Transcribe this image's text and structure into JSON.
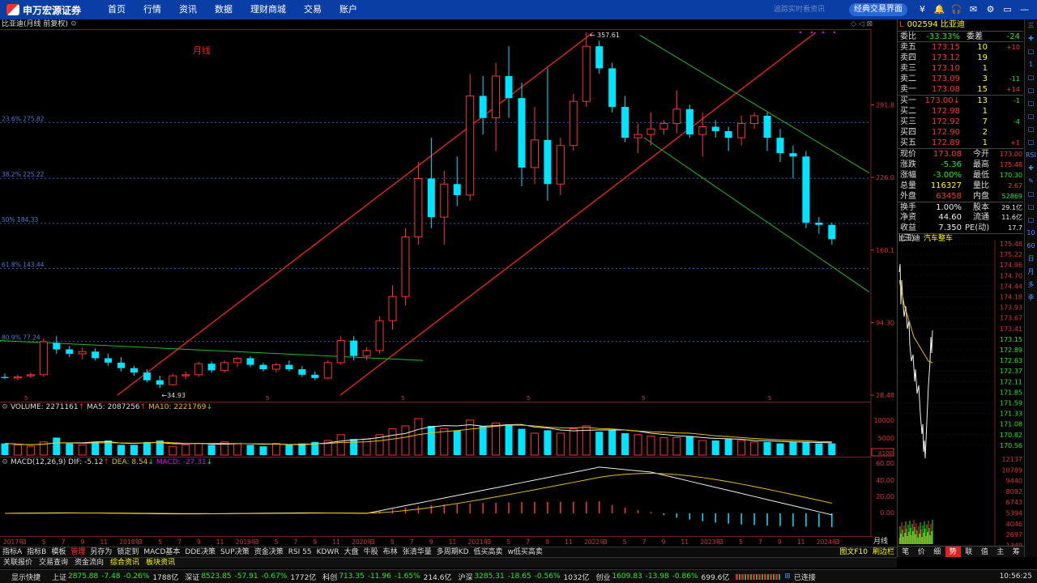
{
  "topbar": {
    "logo_text": "申万宏源证券",
    "nav": [
      "首页",
      "行情",
      "资讯",
      "数据",
      "理财商城",
      "交易",
      "账户"
    ],
    "faint_text": "追踪实时看资讯",
    "classic_button": "经典交易界面",
    "icons": [
      "¥",
      "🔔",
      "🎧",
      "✉",
      "⚙",
      "▭",
      "—",
      "▢",
      "✕"
    ]
  },
  "chart": {
    "title": "比亚迪(月线 前复权)",
    "period_label": "月线",
    "high_mark": "357.61",
    "low_mark": "34.93",
    "fib_labels": [
      {
        "label": "23.6% 275.82",
        "price": 275.82
      },
      {
        "label": "38.2% 225.22",
        "price": 225.22
      },
      {
        "label": "50% 184.33",
        "price": 184.33
      },
      {
        "label": "61.8% 143.44",
        "price": 143.44
      },
      {
        "label": "80.9% 77.24",
        "price": 77.24
      }
    ],
    "y_axis_labels": [
      {
        "label": "291.8",
        "price": 291.8
      },
      {
        "label": "226.0",
        "price": 226.0
      },
      {
        "label": "160.1",
        "price": 160.1
      },
      {
        "label": "94.30",
        "price": 94.3
      },
      {
        "label": "28.48",
        "price": 28.48
      }
    ],
    "y_range": [
      28.48,
      357.61
    ],
    "x_marks": [
      "5",
      "5",
      "5",
      "5",
      "5",
      "5"
    ]
  },
  "chart_data": {
    "type": "candlestick",
    "x_tick_labels": [
      "2017年",
      "3",
      "5",
      "7",
      "9",
      "11",
      "2018年",
      "3",
      "5",
      "7",
      "9",
      "11",
      "2019年",
      "3",
      "5",
      "7",
      "9",
      "11",
      "2020年",
      "3",
      "5",
      "7",
      "9",
      "11",
      "2021年",
      "3",
      "5",
      "7",
      "9",
      "11",
      "2022年",
      "3",
      "5",
      "7",
      "9",
      "11",
      "2023年",
      "3",
      "5",
      "7",
      "9",
      "11",
      "2024年",
      "3"
    ],
    "candles": [
      [
        45,
        48,
        43,
        44
      ],
      [
        44,
        47,
        42,
        45
      ],
      [
        46,
        49,
        44,
        47
      ],
      [
        47,
        80,
        45,
        77
      ],
      [
        76,
        82,
        66,
        70
      ],
      [
        70,
        73,
        63,
        66
      ],
      [
        66,
        72,
        61,
        68
      ],
      [
        68,
        71,
        60,
        62
      ],
      [
        62,
        66,
        55,
        58
      ],
      [
        58,
        63,
        50,
        53
      ],
      [
        53,
        55,
        46,
        49
      ],
      [
        49,
        52,
        40,
        42
      ],
      [
        42,
        46,
        34.93,
        38
      ],
      [
        38,
        48,
        37,
        46
      ],
      [
        46,
        50,
        43,
        47
      ],
      [
        47,
        59,
        45,
        57
      ],
      [
        57,
        59,
        49,
        51
      ],
      [
        51,
        60,
        49,
        58
      ],
      [
        58,
        63,
        54,
        62
      ],
      [
        62,
        64,
        54,
        56
      ],
      [
        56,
        58,
        50,
        52
      ],
      [
        52,
        58,
        49,
        56
      ],
      [
        56,
        60,
        50,
        52
      ],
      [
        52,
        55,
        45,
        47
      ],
      [
        47,
        50,
        42,
        44
      ],
      [
        44,
        60,
        43,
        58
      ],
      [
        58,
        82,
        56,
        78
      ],
      [
        78,
        82,
        60,
        64
      ],
      [
        64,
        72,
        60,
        69
      ],
      [
        69,
        100,
        66,
        96
      ],
      [
        96,
        128,
        88,
        118
      ],
      [
        118,
        180,
        110,
        172
      ],
      [
        172,
        240,
        165,
        225
      ],
      [
        225,
        262,
        180,
        190
      ],
      [
        190,
        232,
        165,
        220
      ],
      [
        220,
        245,
        200,
        210
      ],
      [
        210,
        320,
        205,
        300
      ],
      [
        300,
        318,
        265,
        280
      ],
      [
        280,
        330,
        250,
        318
      ],
      [
        318,
        345,
        280,
        298
      ],
      [
        298,
        312,
        218,
        235
      ],
      [
        235,
        290,
        220,
        260
      ],
      [
        260,
        325,
        205,
        220
      ],
      [
        220,
        262,
        210,
        255
      ],
      [
        255,
        302,
        250,
        295
      ],
      [
        295,
        357.61,
        290,
        345
      ],
      [
        345,
        350,
        320,
        325
      ],
      [
        325,
        330,
        285,
        290
      ],
      [
        290,
        300,
        258,
        262
      ],
      [
        262,
        275,
        248,
        265
      ],
      [
        265,
        285,
        255,
        270
      ],
      [
        270,
        278,
        265,
        275
      ],
      [
        275,
        305,
        266,
        288
      ],
      [
        288,
        292,
        262,
        265
      ],
      [
        265,
        285,
        245,
        272
      ],
      [
        272,
        278,
        262,
        268
      ],
      [
        268,
        272,
        250,
        262
      ],
      [
        262,
        282,
        255,
        275
      ],
      [
        275,
        285,
        270,
        282
      ],
      [
        282,
        285,
        250,
        262
      ],
      [
        262,
        270,
        240,
        248
      ],
      [
        248,
        255,
        225,
        245
      ],
      [
        245,
        250,
        180,
        185
      ],
      [
        185,
        190,
        175,
        183
      ],
      [
        183,
        185,
        165,
        170
      ]
    ],
    "volume_axis": [
      "10000",
      "5000",
      "X100"
    ],
    "macd_axis": [
      "60.00",
      "40.00",
      "20.00",
      "0.00"
    ],
    "volume_legend": {
      "volume": "VOLUME: 2271161",
      "ma5": "MA5: 2087256",
      "ma10": "MA10: 2221769"
    },
    "macd_legend": {
      "name": "MACD(12,26,9)",
      "dif": "DIF: -5.12",
      "dea": "DEA: 8.54",
      "macd": "MACD: -27.31"
    }
  },
  "quote": {
    "code_name": "002594 比亚迪",
    "l_mark": "L",
    "weibi_label": "委比",
    "weibi": "-33.33%",
    "weicha_label": "委差",
    "weicha": "-24",
    "asks": [
      {
        "label": "卖五",
        "price": "173.15",
        "vol": "10",
        "chg": "+10"
      },
      {
        "label": "卖四",
        "price": "173.12",
        "vol": "19",
        "chg": ""
      },
      {
        "label": "卖三",
        "price": "173.10",
        "vol": "1",
        "chg": ""
      },
      {
        "label": "卖二",
        "price": "173.09",
        "vol": "3",
        "chg": "-11"
      },
      {
        "label": "卖一",
        "price": "173.08",
        "vol": "15",
        "chg": "+14"
      }
    ],
    "bids": [
      {
        "label": "买一",
        "price": "173.00↓",
        "vol": "13",
        "chg": "-1"
      },
      {
        "label": "买二",
        "price": "172.98",
        "vol": "1",
        "chg": ""
      },
      {
        "label": "买三",
        "price": "172.92",
        "vol": "7",
        "chg": "-4"
      },
      {
        "label": "买四",
        "price": "172.90",
        "vol": "2",
        "chg": ""
      },
      {
        "label": "买五",
        "price": "172.89",
        "vol": "1",
        "chg": "+1"
      }
    ],
    "stats": [
      [
        "现价",
        "173.08",
        "今开",
        "173.00"
      ],
      [
        "涨跌",
        "-5.36",
        "最高",
        "175.48"
      ],
      [
        "涨幅",
        "-3.00%",
        "最低",
        "170.30"
      ],
      [
        "总量",
        "116327",
        "量比",
        "2.67"
      ],
      [
        "外盘",
        "63458",
        "内盘",
        "52869"
      ],
      [
        "换手",
        "1.00%",
        "股本",
        "29.1亿"
      ],
      [
        "净资",
        "44.60",
        "流通",
        "11.6亿"
      ],
      [
        "收益(三)",
        "7.350",
        "PE(动)",
        "17.7"
      ]
    ],
    "tick_head_name": "比亚迪",
    "tick_head_sector": "汽车整车",
    "tick_prices": [
      "175.48",
      "175.22",
      "174.96",
      "174.70",
      "174.44",
      "174.18",
      "173.93",
      "173.67",
      "173.41",
      "173.15",
      "172.89",
      "172.63",
      "172.37",
      "172.11",
      "171.85",
      "171.59",
      "171.33",
      "171.08",
      "170.82",
      "170.56"
    ],
    "tick_vols": [
      "12137",
      "10789",
      "9440",
      "8092",
      "6743",
      "5394",
      "4046",
      "2697",
      "1349"
    ],
    "footer_tabs": [
      "笔",
      "价",
      "细",
      "势",
      "联",
      "值",
      "主",
      "筹"
    ]
  },
  "sidebar_icons": [
    "三",
    "✚",
    "□",
    "1",
    "□",
    "□",
    "□",
    "□",
    "□",
    "□",
    "RSI",
    "✚",
    "✎",
    "□",
    "□",
    "□",
    "10",
    "60",
    "日",
    "月",
    "多",
    "季"
  ],
  "tabs_row1": [
    "指标A",
    "指标B",
    "模板",
    "管理",
    "另存为",
    "锁定到",
    "MACD基本",
    "DDE决策",
    "SUP决策",
    "资金决策",
    "RSI 55",
    "KDWR",
    "大盘",
    "牛股",
    "布林",
    "张清华量",
    "多周期KD",
    "低买高卖",
    "w低买高卖"
  ],
  "tabs_row1_right": [
    "图文F10",
    "刷边栏"
  ],
  "tabs_row2": [
    "关联报价",
    "交易查询",
    "资金流向",
    "综合资讯",
    "板块资讯"
  ],
  "status": {
    "app": "显示快捷",
    "items": [
      {
        "label": "上证",
        "v": "2875.88",
        "c": "-7.48",
        "p": "-0.26%",
        "a": "1788亿"
      },
      {
        "label": "深证",
        "v": "8523.85",
        "c": "-57.91",
        "p": "-0.67%",
        "a": "1772亿"
      },
      {
        "label": "科创",
        "v": "713.35",
        "c": "-11.96",
        "p": "-1.65%",
        "a": "214.6亿"
      },
      {
        "label": "沪深",
        "v": "3285.31",
        "c": "-18.65",
        "p": "-0.56%",
        "a": "1032亿"
      },
      {
        "label": "创业",
        "v": "1609.83",
        "c": "-13.98",
        "p": "-0.86%",
        "a": "699.6亿"
      }
    ],
    "connected": "已连接",
    "clock": "10:56:25"
  },
  "colors": {
    "up": "#ff3333",
    "down": "#00e5ff",
    "channel": "#ff2222",
    "trend": "#22bb22",
    "ma5": "#eeeeee",
    "ma10": "#e8c000",
    "dea": "#e8c000"
  }
}
